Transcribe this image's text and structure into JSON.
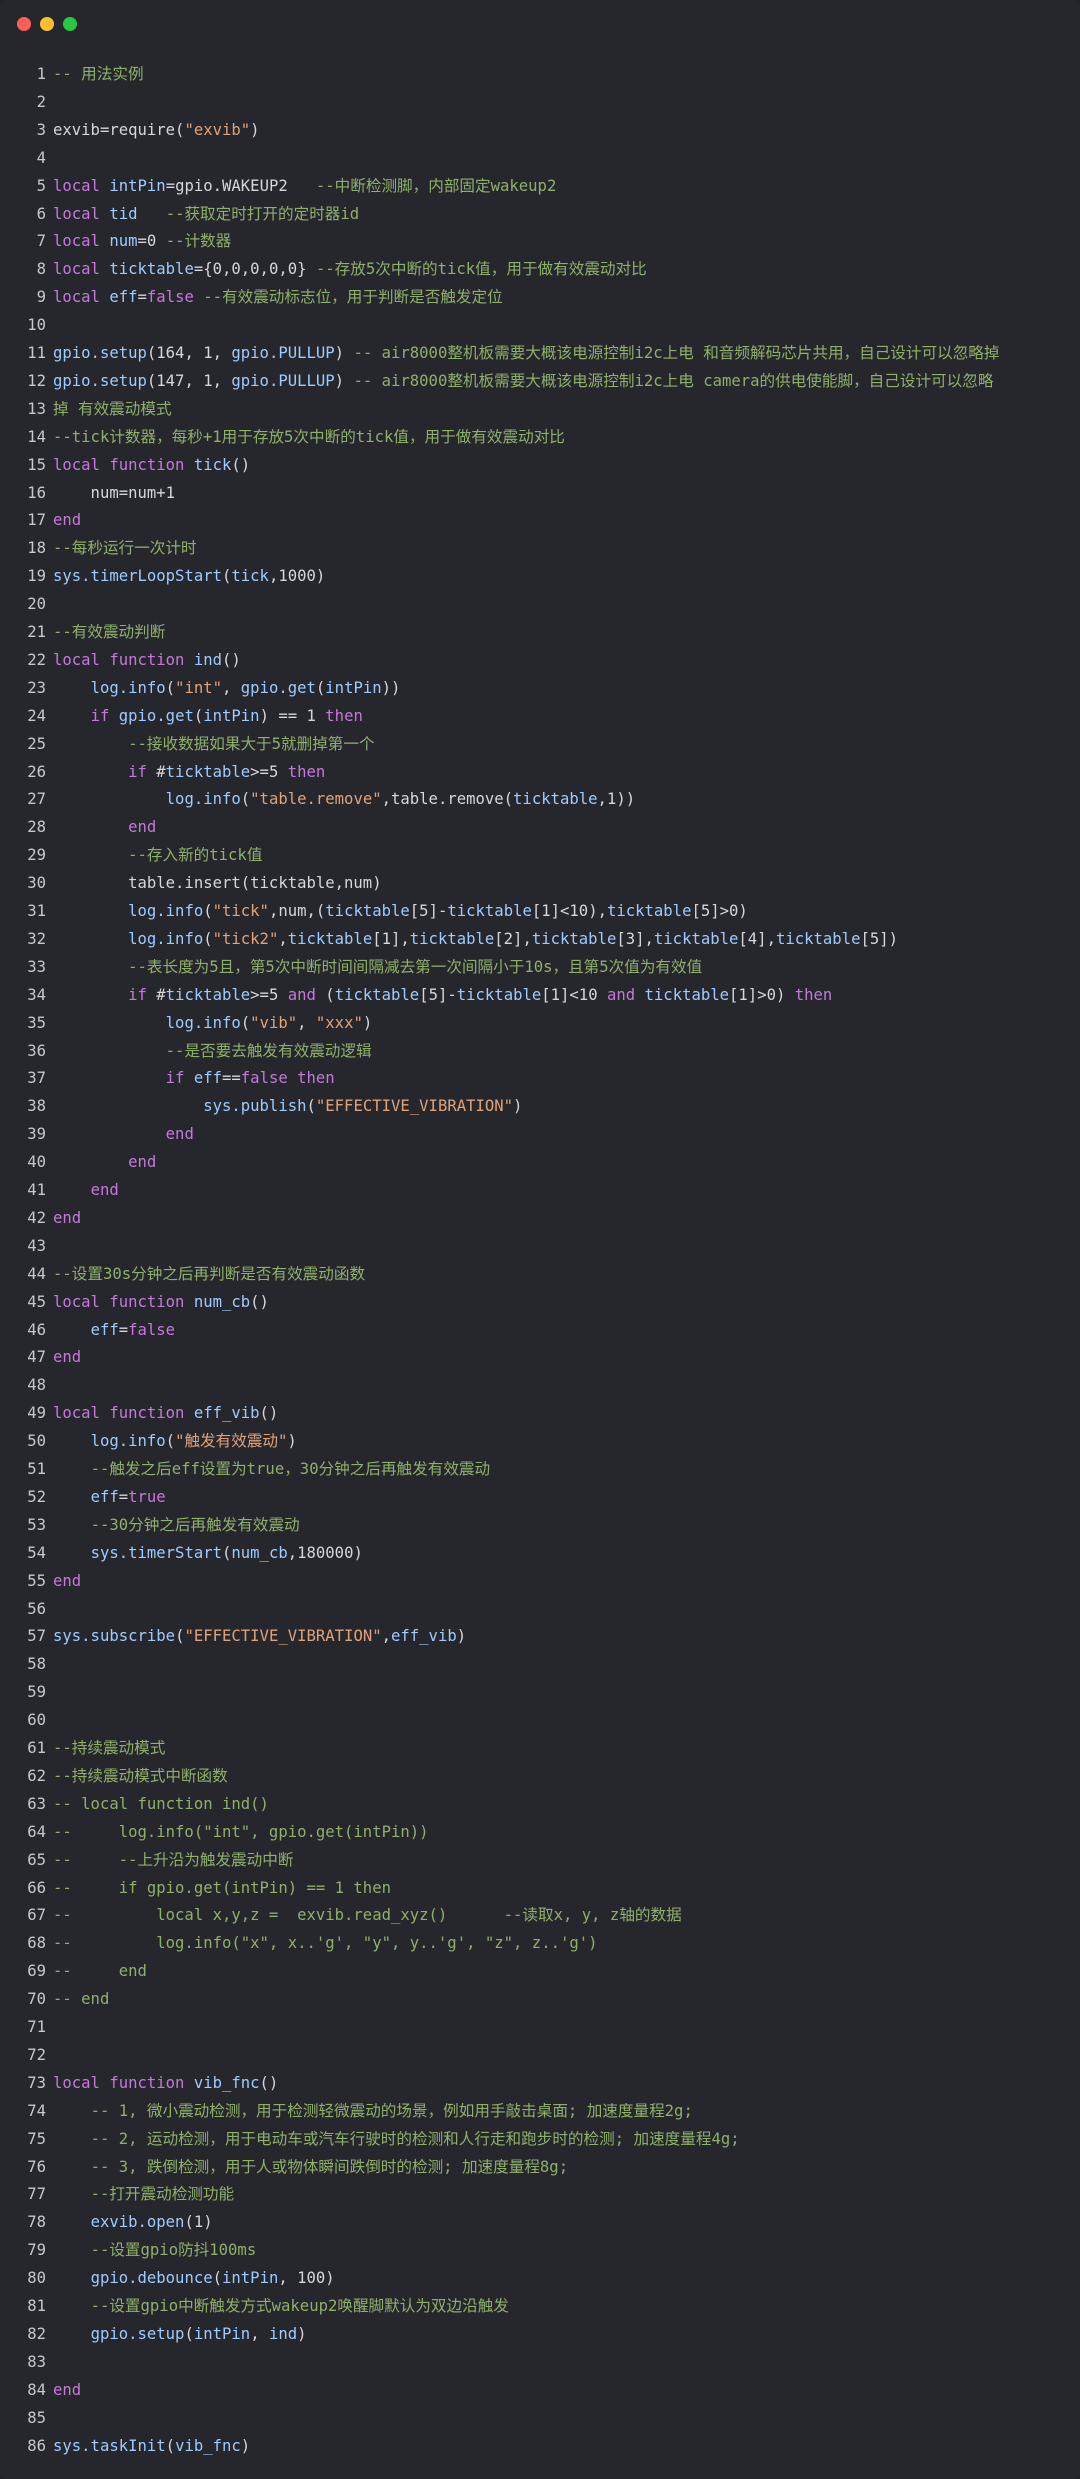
{
  "window": {
    "controls": [
      {
        "name": "close-button",
        "color": "#ff5f57"
      },
      {
        "name": "minimize-button",
        "color": "#febc2e"
      },
      {
        "name": "maximize-button",
        "color": "#28c840"
      }
    ]
  },
  "code": {
    "lines": [
      [
        [
          "cmt",
          "-- 用法实例"
        ]
      ],
      [],
      [
        [
          "txt",
          "exvib=require("
        ],
        [
          "str",
          "\"exvib\""
        ],
        [
          "txt",
          ")"
        ]
      ],
      [],
      [
        [
          "kw",
          "local "
        ],
        [
          "id",
          "intPin"
        ],
        [
          "txt",
          "=gpio.WAKEUP2   "
        ],
        [
          "cmt",
          "--中断检测脚，内部固定wakeup2"
        ]
      ],
      [
        [
          "kw",
          "local "
        ],
        [
          "id",
          "tid"
        ],
        [
          "txt",
          "   "
        ],
        [
          "cmt",
          "--获取定时打开的定时器id"
        ]
      ],
      [
        [
          "kw",
          "local "
        ],
        [
          "id",
          "num"
        ],
        [
          "txt",
          "=0 "
        ],
        [
          "cmt",
          "--计数器"
        ]
      ],
      [
        [
          "kw",
          "local "
        ],
        [
          "id",
          "ticktable"
        ],
        [
          "txt",
          "={0,0,0,0,0} "
        ],
        [
          "cmt",
          "--存放5次中断的tick值，用于做有效震动对比"
        ]
      ],
      [
        [
          "kw",
          "local "
        ],
        [
          "id",
          "eff"
        ],
        [
          "txt",
          "="
        ],
        [
          "kw",
          "false"
        ],
        [
          "txt",
          " "
        ],
        [
          "cmt",
          "--有效震动标志位，用于判断是否触发定位"
        ]
      ],
      [],
      [
        [
          "fn",
          "gpio.setup"
        ],
        [
          "txt",
          "(164, 1, "
        ],
        [
          "id",
          "gpio.PULLUP"
        ],
        [
          "txt",
          ") "
        ],
        [
          "cmt",
          "-- air8000整机板需要大概该电源控制i2c上电 和音频解码芯片共用，自己设计可以忽略掉"
        ]
      ],
      [
        [
          "fn",
          "gpio.setup"
        ],
        [
          "txt",
          "(147, 1, "
        ],
        [
          "id",
          "gpio.PULLUP"
        ],
        [
          "txt",
          ") "
        ],
        [
          "cmt",
          "-- air8000整机板需要大概该电源控制i2c上电 camera的供电使能脚，自己设计可以忽略"
        ]
      ],
      [
        [
          "cmt",
          "掉 有效震动模式"
        ]
      ],
      [
        [
          "cmt",
          "--tick计数器，每秒+1用于存放5次中断的tick值，用于做有效震动对比"
        ]
      ],
      [
        [
          "kw",
          "local function "
        ],
        [
          "fn",
          "tick"
        ],
        [
          "txt",
          "()"
        ]
      ],
      [
        [
          "txt",
          "    num=num+1"
        ]
      ],
      [
        [
          "kw",
          "end"
        ]
      ],
      [
        [
          "cmt",
          "--每秒运行一次计时"
        ]
      ],
      [
        [
          "fn",
          "sys.timerLoopStart"
        ],
        [
          "txt",
          "("
        ],
        [
          "id",
          "tick"
        ],
        [
          "txt",
          ",1000)"
        ]
      ],
      [],
      [
        [
          "cmt",
          "--有效震动判断"
        ]
      ],
      [
        [
          "kw",
          "local function "
        ],
        [
          "fn",
          "ind"
        ],
        [
          "txt",
          "()"
        ]
      ],
      [
        [
          "txt",
          "    "
        ],
        [
          "fn",
          "log.info"
        ],
        [
          "txt",
          "("
        ],
        [
          "str",
          "\"int\""
        ],
        [
          "txt",
          ", "
        ],
        [
          "fn",
          "gpio.get"
        ],
        [
          "txt",
          "("
        ],
        [
          "id",
          "intPin"
        ],
        [
          "txt",
          "))"
        ]
      ],
      [
        [
          "txt",
          "    "
        ],
        [
          "kw",
          "if "
        ],
        [
          "fn",
          "gpio.get"
        ],
        [
          "txt",
          "("
        ],
        [
          "id",
          "intPin"
        ],
        [
          "txt",
          ") == 1 "
        ],
        [
          "kw",
          "then"
        ]
      ],
      [
        [
          "txt",
          "        "
        ],
        [
          "cmt",
          "--接收数据如果大于5就删掉第一个"
        ]
      ],
      [
        [
          "txt",
          "        "
        ],
        [
          "kw",
          "if "
        ],
        [
          "txt",
          "#"
        ],
        [
          "id",
          "ticktable"
        ],
        [
          "txt",
          ">=5 "
        ],
        [
          "kw",
          "then"
        ]
      ],
      [
        [
          "txt",
          "            "
        ],
        [
          "fn",
          "log.info"
        ],
        [
          "txt",
          "("
        ],
        [
          "str",
          "\"table.remove\""
        ],
        [
          "txt",
          ",table.remove("
        ],
        [
          "id",
          "ticktable"
        ],
        [
          "txt",
          ",1))"
        ]
      ],
      [
        [
          "txt",
          "        "
        ],
        [
          "kw",
          "end"
        ]
      ],
      [
        [
          "txt",
          "        "
        ],
        [
          "cmt",
          "--存入新的tick值"
        ]
      ],
      [
        [
          "txt",
          "        table.insert(ticktable,num)"
        ]
      ],
      [
        [
          "txt",
          "        "
        ],
        [
          "fn",
          "log.info"
        ],
        [
          "txt",
          "("
        ],
        [
          "str",
          "\"tick\""
        ],
        [
          "txt",
          ",num,("
        ],
        [
          "id",
          "ticktable"
        ],
        [
          "txt",
          "[5]-"
        ],
        [
          "id",
          "ticktable"
        ],
        [
          "txt",
          "[1]<10),"
        ],
        [
          "id",
          "ticktable"
        ],
        [
          "txt",
          "[5]>0)"
        ]
      ],
      [
        [
          "txt",
          "        "
        ],
        [
          "fn",
          "log.info"
        ],
        [
          "txt",
          "("
        ],
        [
          "str",
          "\"tick2\""
        ],
        [
          "txt",
          ","
        ],
        [
          "id",
          "ticktable"
        ],
        [
          "txt",
          "[1],"
        ],
        [
          "id",
          "ticktable"
        ],
        [
          "txt",
          "[2],"
        ],
        [
          "id",
          "ticktable"
        ],
        [
          "txt",
          "[3],"
        ],
        [
          "id",
          "ticktable"
        ],
        [
          "txt",
          "[4],"
        ],
        [
          "id",
          "ticktable"
        ],
        [
          "txt",
          "[5])"
        ]
      ],
      [
        [
          "txt",
          "        "
        ],
        [
          "cmt",
          "--表长度为5且，第5次中断时间间隔减去第一次间隔小于10s，且第5次值为有效值"
        ]
      ],
      [
        [
          "txt",
          "        "
        ],
        [
          "kw",
          "if "
        ],
        [
          "txt",
          "#"
        ],
        [
          "id",
          "ticktable"
        ],
        [
          "txt",
          ">=5 "
        ],
        [
          "kw",
          "and"
        ],
        [
          "txt",
          " ("
        ],
        [
          "id",
          "ticktable"
        ],
        [
          "txt",
          "[5]-"
        ],
        [
          "id",
          "ticktable"
        ],
        [
          "txt",
          "[1]<10 "
        ],
        [
          "kw",
          "and"
        ],
        [
          "txt",
          " "
        ],
        [
          "id",
          "ticktable"
        ],
        [
          "txt",
          "[1]>0) "
        ],
        [
          "kw",
          "then"
        ]
      ],
      [
        [
          "txt",
          "            "
        ],
        [
          "fn",
          "log.info"
        ],
        [
          "txt",
          "("
        ],
        [
          "str",
          "\"vib\""
        ],
        [
          "txt",
          ", "
        ],
        [
          "str",
          "\"xxx\""
        ],
        [
          "txt",
          ")"
        ]
      ],
      [
        [
          "txt",
          "            "
        ],
        [
          "cmt",
          "--是否要去触发有效震动逻辑"
        ]
      ],
      [
        [
          "txt",
          "            "
        ],
        [
          "kw",
          "if "
        ],
        [
          "id",
          "eff"
        ],
        [
          "txt",
          "=="
        ],
        [
          "kw",
          "false then"
        ]
      ],
      [
        [
          "txt",
          "                "
        ],
        [
          "fn",
          "sys.publish"
        ],
        [
          "txt",
          "("
        ],
        [
          "str",
          "\"EFFECTIVE_VIBRATION\""
        ],
        [
          "txt",
          ")"
        ]
      ],
      [
        [
          "txt",
          "            "
        ],
        [
          "kw",
          "end"
        ]
      ],
      [
        [
          "txt",
          "        "
        ],
        [
          "kw",
          "end"
        ]
      ],
      [
        [
          "txt",
          "    "
        ],
        [
          "kw",
          "end"
        ]
      ],
      [
        [
          "kw",
          "end"
        ]
      ],
      [],
      [
        [
          "cmt",
          "--设置30s分钟之后再判断是否有效震动函数"
        ]
      ],
      [
        [
          "kw",
          "local function "
        ],
        [
          "fn",
          "num_cb"
        ],
        [
          "txt",
          "()"
        ]
      ],
      [
        [
          "txt",
          "    "
        ],
        [
          "id",
          "eff"
        ],
        [
          "txt",
          "="
        ],
        [
          "kw",
          "false"
        ]
      ],
      [
        [
          "kw",
          "end"
        ]
      ],
      [],
      [
        [
          "kw",
          "local function "
        ],
        [
          "fn",
          "eff_vib"
        ],
        [
          "txt",
          "()"
        ]
      ],
      [
        [
          "txt",
          "    "
        ],
        [
          "fn",
          "log.info"
        ],
        [
          "txt",
          "("
        ],
        [
          "str",
          "\"触发有效震动\""
        ],
        [
          "txt",
          ")"
        ]
      ],
      [
        [
          "txt",
          "    "
        ],
        [
          "cmt",
          "--触发之后eff设置为true，30分钟之后再触发有效震动"
        ]
      ],
      [
        [
          "txt",
          "    "
        ],
        [
          "id",
          "eff"
        ],
        [
          "txt",
          "="
        ],
        [
          "kw",
          "true"
        ]
      ],
      [
        [
          "txt",
          "    "
        ],
        [
          "cmt",
          "--30分钟之后再触发有效震动"
        ]
      ],
      [
        [
          "txt",
          "    "
        ],
        [
          "fn",
          "sys.timerStart"
        ],
        [
          "txt",
          "("
        ],
        [
          "id",
          "num_cb"
        ],
        [
          "txt",
          ",180000)"
        ]
      ],
      [
        [
          "kw",
          "end"
        ]
      ],
      [],
      [
        [
          "fn",
          "sys.subscribe"
        ],
        [
          "txt",
          "("
        ],
        [
          "str",
          "\"EFFECTIVE_VIBRATION\""
        ],
        [
          "txt",
          ","
        ],
        [
          "id",
          "eff_vib"
        ],
        [
          "txt",
          ")"
        ]
      ],
      [],
      [],
      [],
      [
        [
          "cmt",
          "--持续震动模式"
        ]
      ],
      [
        [
          "cmt",
          "--持续震动模式中断函数"
        ]
      ],
      [
        [
          "cmt",
          "-- local function ind()"
        ]
      ],
      [
        [
          "cmt",
          "--     log.info(\"int\", gpio.get(intPin))"
        ]
      ],
      [
        [
          "cmt",
          "--     --上升沿为触发震动中断"
        ]
      ],
      [
        [
          "cmt",
          "--     if gpio.get(intPin) == 1 then"
        ]
      ],
      [
        [
          "cmt",
          "--         local x,y,z =  exvib.read_xyz()      --读取x, y, z轴的数据"
        ]
      ],
      [
        [
          "cmt",
          "--         log.info(\"x\", x..'g', \"y\", y..'g', \"z\", z..'g')"
        ]
      ],
      [
        [
          "cmt",
          "--     end"
        ]
      ],
      [
        [
          "cmt",
          "-- end"
        ]
      ],
      [],
      [],
      [
        [
          "kw",
          "local function "
        ],
        [
          "fn",
          "vib_fnc"
        ],
        [
          "txt",
          "()"
        ]
      ],
      [
        [
          "txt",
          "    "
        ],
        [
          "cmt",
          "-- 1, 微小震动检测，用于检测轻微震动的场景，例如用手敲击桌面; 加速度量程2g;"
        ]
      ],
      [
        [
          "txt",
          "    "
        ],
        [
          "cmt",
          "-- 2, 运动检测，用于电动车或汽车行驶时的检测和人行走和跑步时的检测; 加速度量程4g;"
        ]
      ],
      [
        [
          "txt",
          "    "
        ],
        [
          "cmt",
          "-- 3, 跌倒检测，用于人或物体瞬间跌倒时的检测; 加速度量程8g;"
        ]
      ],
      [
        [
          "txt",
          "    "
        ],
        [
          "cmt",
          "--打开震动检测功能"
        ]
      ],
      [
        [
          "txt",
          "    "
        ],
        [
          "fn",
          "exvib.open"
        ],
        [
          "txt",
          "(1)"
        ]
      ],
      [
        [
          "txt",
          "    "
        ],
        [
          "cmt",
          "--设置gpio防抖100ms"
        ]
      ],
      [
        [
          "txt",
          "    "
        ],
        [
          "fn",
          "gpio.debounce"
        ],
        [
          "txt",
          "("
        ],
        [
          "id",
          "intPin"
        ],
        [
          "txt",
          ", 100)"
        ]
      ],
      [
        [
          "txt",
          "    "
        ],
        [
          "cmt",
          "--设置gpio中断触发方式wakeup2唤醒脚默认为双边沿触发"
        ]
      ],
      [
        [
          "txt",
          "    "
        ],
        [
          "fn",
          "gpio.setup"
        ],
        [
          "txt",
          "("
        ],
        [
          "id",
          "intPin"
        ],
        [
          "txt",
          ", "
        ],
        [
          "id",
          "ind"
        ],
        [
          "txt",
          ")"
        ]
      ],
      [],
      [
        [
          "kw",
          "end"
        ]
      ],
      [],
      [
        [
          "fn",
          "sys.taskInit"
        ],
        [
          "txt",
          "("
        ],
        [
          "id",
          "vib_fnc"
        ],
        [
          "txt",
          ")"
        ]
      ]
    ]
  }
}
